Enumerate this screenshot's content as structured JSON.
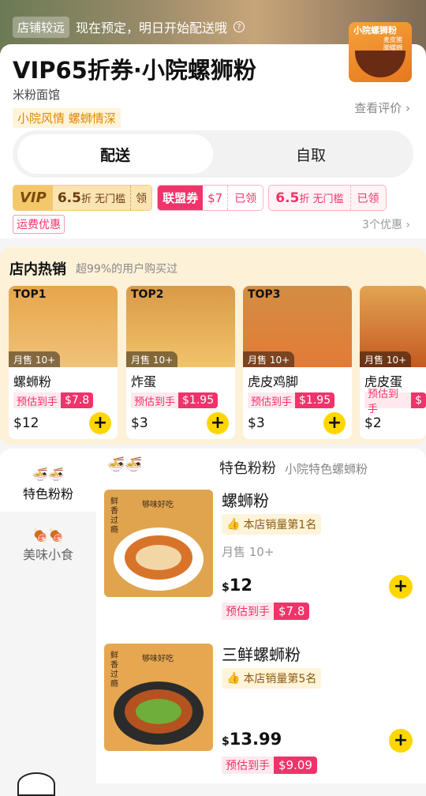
{
  "notice": {
    "tag": "店铺较远",
    "text": "现在预定，明日开始配送哦",
    "help": "?"
  },
  "store": {
    "title": "VIP65折券·小院螺狮粉",
    "category": "米粉面馆",
    "slogan": "小院风情 螺蛳情深",
    "review_link": "查看评价 ›",
    "logo_text": "小院螺狮粉",
    "logo_sub": "麦皮猪脚螺蛳粉"
  },
  "tabs": {
    "delivery": "配送",
    "pickup": "自取"
  },
  "coupons": {
    "vip": {
      "badge": "VIP",
      "pct": "6.5",
      "unit": "折",
      "cond": "无门槛",
      "action": "领"
    },
    "league": {
      "badge": "联盟券",
      "amount": "$7",
      "action": "已领"
    },
    "pct": {
      "pct": "6.5",
      "unit": "折",
      "cond": "无门槛",
      "action": "已领"
    }
  },
  "shipping": {
    "label": "运费优惠",
    "more": "3个优惠 ›"
  },
  "hot": {
    "title": "店内热销",
    "subtitle": "超99%的用户购买过",
    "items": [
      {
        "rank": "TOP1",
        "sold": "月售 10+",
        "name": "螺蛳粉",
        "est_label": "预估到手",
        "est": "$7.8",
        "price": "$12"
      },
      {
        "rank": "TOP2",
        "sold": "月售 10+",
        "name": "炸蛋",
        "est_label": "预估到手",
        "est": "$1.95",
        "price": "$3"
      },
      {
        "rank": "TOP3",
        "sold": "月售 10+",
        "name": "虎皮鸡脚",
        "est_label": "预估到手",
        "est": "$1.95",
        "price": "$3"
      },
      {
        "rank": "",
        "sold": "月售 10+",
        "name": "虎皮蛋",
        "est_label": "预估到手",
        "est": "$",
        "price": "$2"
      }
    ]
  },
  "sidebar": {
    "items": [
      {
        "label": "特色粉粉",
        "icon": "🍜🍜"
      },
      {
        "label": "美味小食",
        "icon": "🍖🍖"
      }
    ]
  },
  "category": {
    "title": "特色粉粉",
    "subtitle": "小院特色螺蛳粉",
    "icon": "🍜🍜"
  },
  "dishes": [
    {
      "name": "螺蛳粉",
      "badge": "本店销量第1名",
      "monthly": "月售 10+",
      "currency": "$",
      "price": "12",
      "est_label": "预估到手",
      "est": "$7.8",
      "img_text_a": "鲜香过瘾",
      "img_text_b": "够味好吃"
    },
    {
      "name": "三鲜螺蛳粉",
      "badge": "本店销量第5名",
      "monthly": "",
      "currency": "$",
      "price": "13.99",
      "est_label": "预估到手",
      "est": "$9.09",
      "img_text_a": "鲜香过瘾",
      "img_text_b": "够味好吃"
    }
  ],
  "plus": "+"
}
